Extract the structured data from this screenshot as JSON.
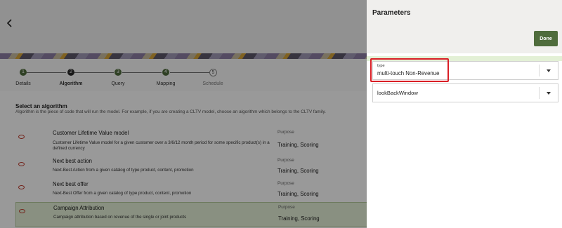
{
  "steps": [
    {
      "num": "1",
      "label": "Details",
      "state": "done"
    },
    {
      "num": "2",
      "label": "Algorithm",
      "state": "current"
    },
    {
      "num": "3",
      "label": "Query",
      "state": "done"
    },
    {
      "num": "4",
      "label": "Mapping",
      "state": "done"
    },
    {
      "num": "5",
      "label": "Schedule",
      "state": "todo"
    }
  ],
  "section": {
    "title": "Select an algorithm",
    "description": "Algorithm is the piece of code that will run the model. For example, if you are creating a CLTV model, choose an algorithm which belongs to the CLTV family."
  },
  "algorithms": [
    {
      "title": "Customer Lifetime Value model",
      "description": "Customer Lifetime Value model for a given customer over a 3/6/12 month period for some specific product(s) in a defined currency",
      "purpose_label": "Purpose",
      "purpose": "Training, Scoring",
      "selected": false
    },
    {
      "title": "Next best action",
      "description": "Next-Best Action from a given catalog of type product, content, promotion",
      "purpose_label": "Purpose",
      "purpose": "Training, Scoring",
      "selected": false
    },
    {
      "title": "Next best offer",
      "description": "Next-Best Offer from a given catalog of type product, content, promotion",
      "purpose_label": "Purpose",
      "purpose": "Training, Scoring",
      "selected": false
    },
    {
      "title": "Campaign Attribution",
      "description": "Campaign attribution based on revenue of the single or joint products",
      "purpose_label": "Purpose",
      "purpose": "Training, Scoring",
      "selected": true
    }
  ],
  "panel": {
    "title": "Parameters",
    "done_label": "Done",
    "type_field": {
      "label": "type",
      "value": "multi-touch Non-Revenue"
    },
    "lookback_field": {
      "value": "lookBackWindow"
    }
  },
  "colors": {
    "accent": "#4f6c3c",
    "highlight": "#d91f26",
    "selected_row": "#e4f0d8"
  }
}
